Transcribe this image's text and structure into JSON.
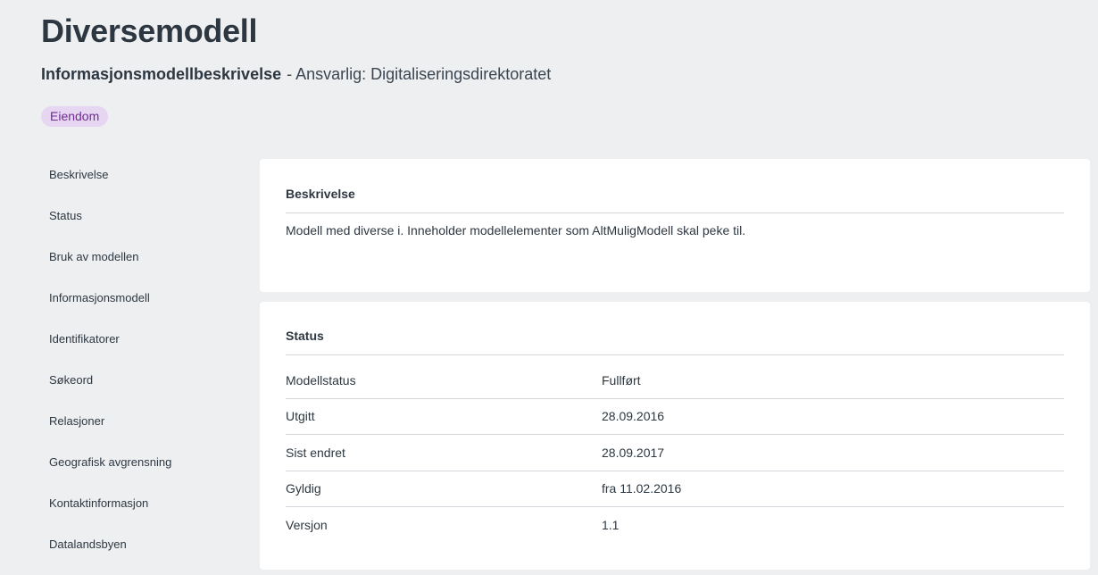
{
  "header": {
    "title": "Diversemodell",
    "subtitle_strong": "Informasjonsmodellbeskrivelse",
    "subtitle_rest": "- Ansvarlig: Digitaliseringsdirektoratet",
    "tag": "Eiendom"
  },
  "sidenav": {
    "items": [
      {
        "label": "Beskrivelse"
      },
      {
        "label": "Status"
      },
      {
        "label": "Bruk av modellen"
      },
      {
        "label": "Informasjonsmodell"
      },
      {
        "label": "Identifikatorer"
      },
      {
        "label": "Søkeord"
      },
      {
        "label": "Relasjoner"
      },
      {
        "label": "Geografisk avgrensning"
      },
      {
        "label": "Kontaktinformasjon"
      },
      {
        "label": "Datalandsbyen"
      }
    ]
  },
  "description": {
    "heading": "Beskrivelse",
    "text": "Modell med diverse i. Inneholder modellelementer som AltMuligModell skal peke til."
  },
  "status": {
    "heading": "Status",
    "rows": [
      {
        "key": "Modellstatus",
        "value": "Fullført"
      },
      {
        "key": "Utgitt",
        "value": "28.09.2016"
      },
      {
        "key": "Sist endret",
        "value": "28.09.2017"
      },
      {
        "key": "Gyldig",
        "value": "fra 11.02.2016"
      },
      {
        "key": "Versjon",
        "value": "1.1"
      }
    ]
  },
  "colors": {
    "background": "#eeeff1",
    "tag_bg": "#e6d6f2",
    "tag_text": "#6f2c91",
    "text": "#2d3741"
  }
}
